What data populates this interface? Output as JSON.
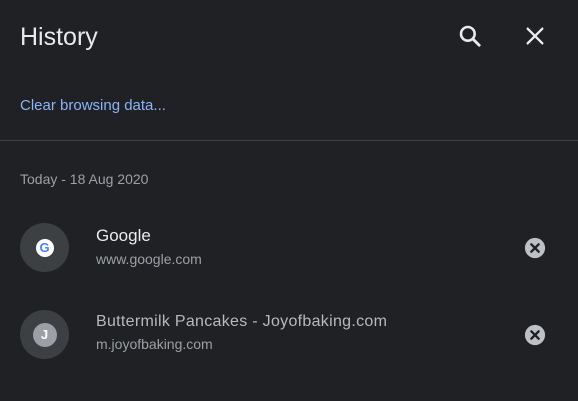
{
  "appbar": {
    "title": "History",
    "search_icon": "search-icon",
    "close_icon": "close-icon"
  },
  "clear_browsing_data": "Clear browsing data...",
  "section": {
    "date_label": "Today - 18 Aug 2020"
  },
  "items": [
    {
      "title": "Google",
      "url": "www.google.com",
      "favicon": "G",
      "favicon_icon": "google-favicon-icon",
      "remove_icon": "remove-circle-icon"
    },
    {
      "title": "Buttermilk Pancakes - Joyofbaking.com",
      "url": "m.joyofbaking.com",
      "favicon": "J",
      "favicon_icon": "letter-favicon-icon",
      "remove_icon": "remove-circle-icon"
    }
  ],
  "colors": {
    "background": "#202124",
    "text_primary": "#e8eaed",
    "text_secondary": "#9aa0a6",
    "link": "#8ab4f8",
    "divider": "#3c4043"
  }
}
